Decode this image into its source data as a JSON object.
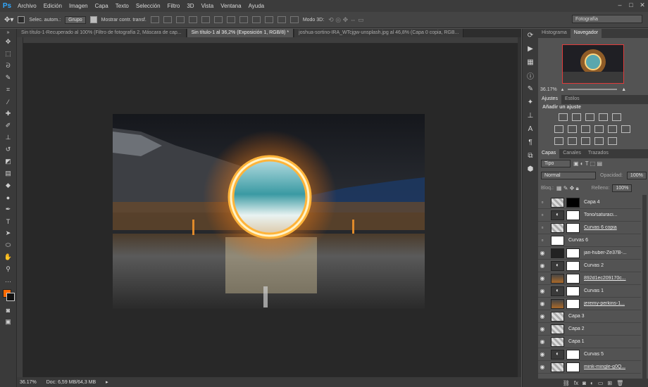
{
  "menu": [
    "Archivo",
    "Edición",
    "Imagen",
    "Capa",
    "Texto",
    "Selección",
    "Filtro",
    "3D",
    "Vista",
    "Ventana",
    "Ayuda"
  ],
  "app": {
    "logo": "Ps"
  },
  "options": {
    "auto_select_label": "Selec. autom.:",
    "auto_select_value": "Grupo",
    "show_transform_label": "Mostrar contr. transf.",
    "mode3d_label": "Modo 3D:",
    "workspace": "Fotografía"
  },
  "tabs": [
    {
      "label": "Sin título-1-Recuperado al 100% (Filtro de fotografía 2, Máscara de cap...",
      "active": false
    },
    {
      "label": "Sin título-1 al 36,2% (Exposición 1, RGB/8) *",
      "active": true
    },
    {
      "label": "joshua-sortino-IRA_WTcjgw-unsplash.jpg al 46,8% (Capa 0 copia, RGB...",
      "active": false
    }
  ],
  "status": {
    "zoom": "36.17%",
    "doc": "Doc: 6,59 MB/64,3 MB"
  },
  "panels": {
    "top_tabs": [
      "Histograma",
      "Navegador"
    ],
    "nav_zoom": "36.17%",
    "adj_tabs": [
      "Ajustes",
      "Estilos"
    ],
    "adj_title": "Añadir un ajuste",
    "layer_tabs": [
      "Capas",
      "Canales",
      "Trazados"
    ],
    "kind": "Tipo",
    "blend": "Normal",
    "opacity_label": "Opacidad:",
    "opacity_value": "100%",
    "lock_label": "Bloq.:",
    "fill_label": "Relleno:",
    "fill_value": "100%"
  },
  "layers": [
    {
      "name": "Capa 4",
      "visible": false,
      "thumb": "checker",
      "mask": "black",
      "adj": false,
      "link": false
    },
    {
      "name": "Tono/saturaci...",
      "visible": false,
      "thumb": "adj",
      "mask": "white",
      "adj": true,
      "link": false
    },
    {
      "name": "Curvas 6 copia",
      "visible": false,
      "thumb": "checker",
      "mask": "white",
      "adj": false,
      "link": true
    },
    {
      "name": "Curvas 6",
      "visible": false,
      "thumb": "white",
      "mask": "none",
      "adj": false,
      "link": false
    },
    {
      "name": "jan-huber-Ze37B-...",
      "visible": true,
      "thumb": "dark",
      "mask": "white",
      "adj": false,
      "link": false
    },
    {
      "name": "Curvas 2",
      "visible": true,
      "thumb": "adj",
      "mask": "white",
      "adj": true,
      "link": false
    },
    {
      "name": "892d1ec209170c...",
      "visible": true,
      "thumb": "photo",
      "mask": "white",
      "adj": false,
      "link": true
    },
    {
      "name": "Curvas 1",
      "visible": true,
      "thumb": "adj",
      "mask": "white",
      "adj": true,
      "link": false
    },
    {
      "name": "jeremy-perkins-1...",
      "visible": true,
      "thumb": "photo",
      "mask": "white",
      "adj": false,
      "link": true
    },
    {
      "name": "Capa 3",
      "visible": true,
      "thumb": "checker",
      "mask": "none",
      "adj": false,
      "link": false
    },
    {
      "name": "Capa 2",
      "visible": true,
      "thumb": "checker",
      "mask": "none",
      "adj": false,
      "link": false
    },
    {
      "name": "Capa 1",
      "visible": true,
      "thumb": "checker",
      "mask": "none",
      "adj": false,
      "link": false
    },
    {
      "name": "Curvas 5",
      "visible": true,
      "thumb": "adj",
      "mask": "white",
      "adj": true,
      "link": false
    },
    {
      "name": "mink-mingle-g0Q...",
      "visible": true,
      "thumb": "checker",
      "mask": "white",
      "adj": false,
      "link": true
    }
  ]
}
